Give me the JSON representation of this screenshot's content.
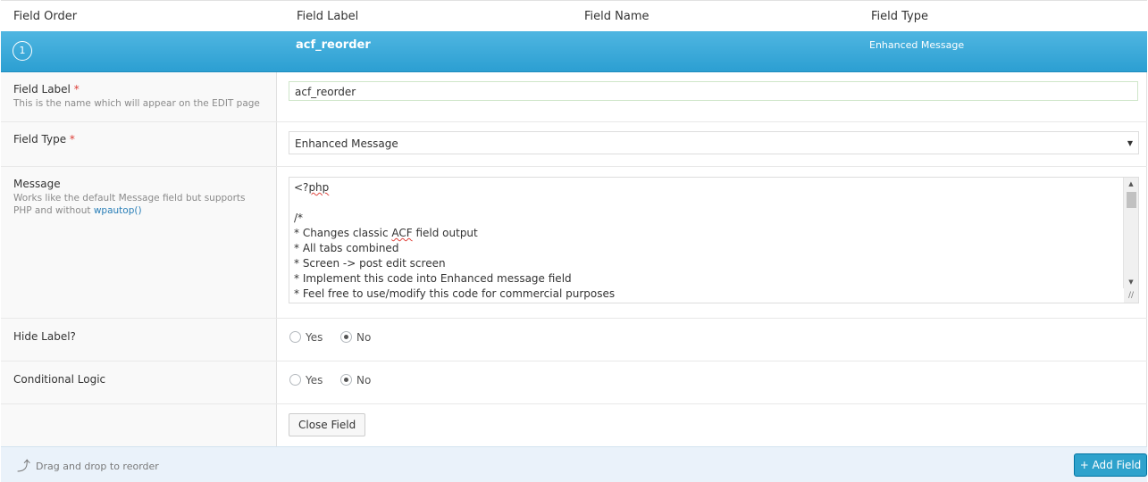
{
  "header": {
    "col_order": "Field Order",
    "col_label": "Field Label",
    "col_name": "Field Name",
    "col_type": "Field Type"
  },
  "field": {
    "order": "1",
    "label": "acf_reorder",
    "type": "Enhanced Message"
  },
  "settings": {
    "label_title": "Field Label",
    "label_desc": "This is the name which will appear on the EDIT page",
    "label_value": "acf_reorder",
    "type_title": "Field Type",
    "type_value": "Enhanced Message",
    "message_title": "Message",
    "message_desc": "Works like the default Message field but supports PHP and without",
    "message_desc_link": "wpautop()",
    "message_lines": [
      "<?php",
      "",
      "/*",
      "* Changes classic ACF field output",
      "* All tabs combined",
      "* Screen -> post edit screen",
      "* Implement this code into Enhanced message field",
      "* Feel free to use/modify this code for commercial purposes"
    ],
    "hide_label_title": "Hide Label?",
    "hide_label_yes": "Yes",
    "hide_label_no": "No",
    "conditional_title": "Conditional Logic",
    "conditional_yes": "Yes",
    "conditional_no": "No",
    "required_mark": "*",
    "close_button": "Close Field"
  },
  "footer": {
    "drag_text": "Drag and drop to reorder",
    "add_button": "+ Add Field"
  },
  "colors": {
    "selected_row": "#2c9fd2",
    "add_button": "#2ea2cc",
    "required": "#dd3d36",
    "footer_bg": "#eaf2fa"
  }
}
